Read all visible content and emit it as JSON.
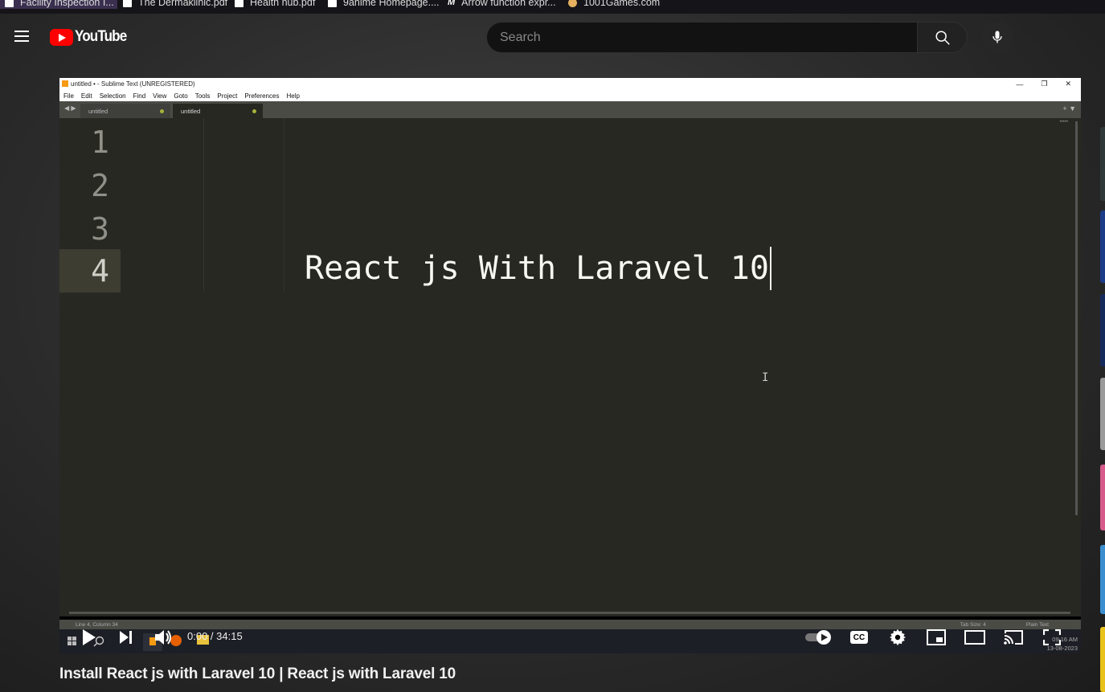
{
  "bookmarks": [
    {
      "label": "Facility Inspection I...",
      "icon": "document-icon"
    },
    {
      "label": "The Dermaklinic.pdf",
      "icon": "document-icon"
    },
    {
      "label": "Health hub.pdf",
      "icon": "document-icon"
    },
    {
      "label": "9anime Homepage....",
      "icon": "document-icon"
    },
    {
      "label": "Arrow function expr...",
      "icon": "mdn-icon"
    },
    {
      "label": "1001Games.com",
      "icon": "games-icon"
    }
  ],
  "header": {
    "logo_text": "YouTube",
    "search_placeholder": "Search"
  },
  "video": {
    "sublime": {
      "window_title": "untitled • - Sublime Text (UNREGISTERED)",
      "menu": [
        "File",
        "Edit",
        "Selection",
        "Find",
        "View",
        "Goto",
        "Tools",
        "Project",
        "Preferences",
        "Help"
      ],
      "tabs": [
        "untitled",
        "untitled"
      ],
      "line_numbers": [
        "1",
        "2",
        "3",
        "4"
      ],
      "code_text": "React js With Laravel 10",
      "status_left": "Line 4, Column 34",
      "status_right": [
        "Tab Size: 4",
        "Plain Text"
      ]
    },
    "clock_time": "09:16 AM",
    "clock_date": "13-08-2023"
  },
  "player": {
    "time_display": "0:00 / 34:15",
    "progress": 0,
    "cc_label": "CC"
  },
  "title": "Install React js with Laravel 10 | React js with Laravel 10",
  "colors": {
    "accent": "#ff0000",
    "editor_bg": "#272822"
  }
}
